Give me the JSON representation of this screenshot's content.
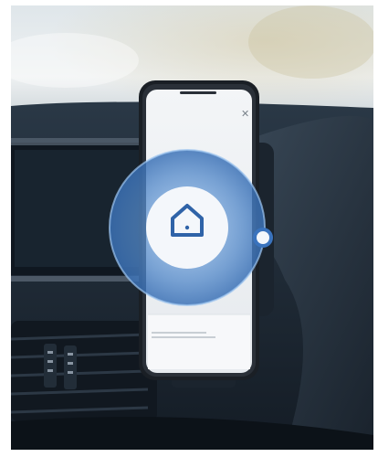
{
  "scene": {
    "description_colors": {
      "sky": "#e9eef2",
      "dashboard": "#1f2b38",
      "app_accent": "#2f63a8",
      "ring_glow": "#6aa8e8"
    }
  },
  "phone_screen": {
    "title": "",
    "close_glyph": "✕",
    "card_heading": "",
    "card_body": "",
    "button_label": "",
    "center_icon": "home-icon"
  }
}
